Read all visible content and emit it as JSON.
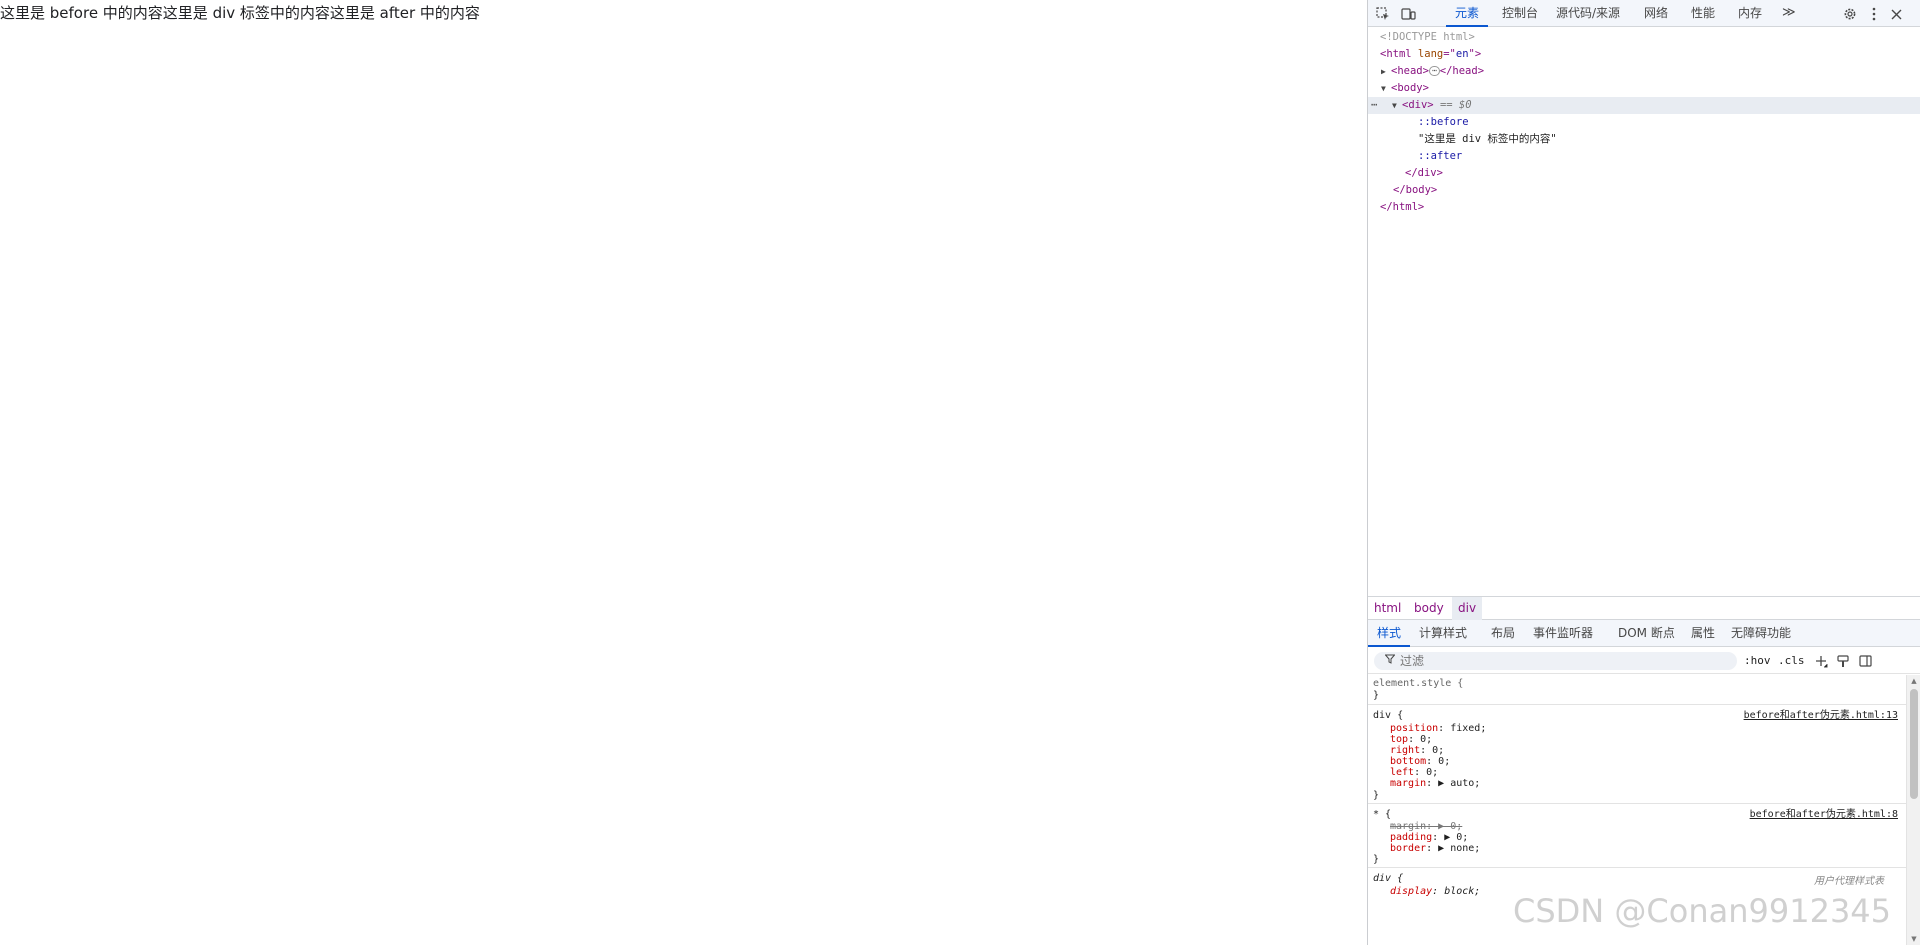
{
  "page": {
    "text": "这里是 before 中的内容这里是 div 标签中的内容这里是 after 中的内容"
  },
  "devtools": {
    "tabs": [
      "元素",
      "控制台",
      "源代码/来源",
      "网络",
      "性能",
      "内存"
    ],
    "active_tab": "元素",
    "more_tabs_glyph": "≫",
    "icons": [
      "inspect-icon",
      "device-toggle-icon",
      "gear-icon",
      "kebab-menu-icon",
      "close-icon"
    ],
    "dom": {
      "doctype": "<!DOCTYPE html>",
      "html_open": "<html",
      "html_attr_name": " lang",
      "html_attr_eq": "=\"",
      "html_attr_value": "en",
      "html_attr_close": "\">",
      "head_open": "<head>",
      "head_badge": "⋯",
      "head_close": "</head>",
      "body_open": "<body>",
      "div_open": "<div>",
      "selected_marker": "== $0",
      "row_dots": "⋯",
      "before_pseudo": "::before",
      "div_text": "\"这里是 div 标签中的内容\"",
      "after_pseudo": "::after",
      "div_close": "</div>",
      "body_close": "</body>",
      "html_close": "</html>"
    },
    "breadcrumb": [
      "html",
      "body",
      "div"
    ],
    "sub_tabs": [
      "样式",
      "计算样式",
      "布局",
      "事件监听器",
      "DOM 断点",
      "属性",
      "无障碍功能"
    ],
    "active_sub_tab": "样式",
    "filter": {
      "placeholder": "过滤",
      "hov": ":hov",
      "cls": ".cls"
    },
    "rules": {
      "element_style": {
        "selector": "element.style {",
        "close": "}"
      },
      "div_rule": {
        "selector": "div {",
        "source": "before和after伪元素.html:13",
        "decls": [
          {
            "prop": "position",
            "value": "fixed;"
          },
          {
            "prop": "top",
            "value": "0;"
          },
          {
            "prop": "right",
            "value": "0;"
          },
          {
            "prop": "bottom",
            "value": "0;"
          },
          {
            "prop": "left",
            "value": "0;"
          },
          {
            "prop": "margin",
            "value": "▶ auto;"
          }
        ],
        "close": "}"
      },
      "star_rule": {
        "selector": "* {",
        "source": "before和after伪元素.html:8",
        "decls": [
          {
            "prop": "margin",
            "value": "▶ 0;"
          },
          {
            "prop": "padding",
            "value": "▶ 0;"
          },
          {
            "prop": "border",
            "value": "▶ none;"
          }
        ],
        "close": "}"
      },
      "ua_rule": {
        "selector": "div {",
        "note": "用户代理样式表",
        "decls": [
          {
            "prop": "display",
            "value": "block;"
          }
        ]
      }
    }
  },
  "watermark": "CSDN @Conan9912345"
}
